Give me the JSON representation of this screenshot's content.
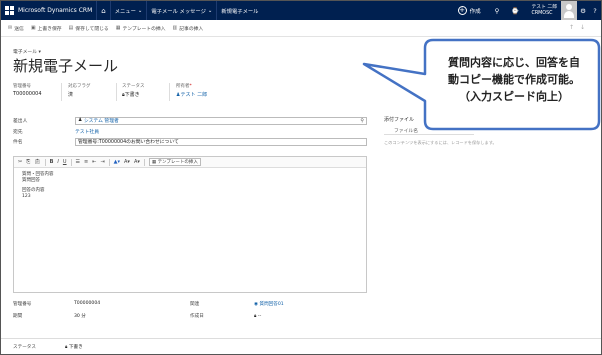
{
  "topnav": {
    "brand": "Microsoft Dynamics CRM",
    "menu_label": "メニュー",
    "area_label": "電子メール メッセージ",
    "record_label": "新規電子メール",
    "new_label": "作成",
    "user_name": "テスト 二郎",
    "user_org": "CRMOSC"
  },
  "commands": [
    {
      "icon": "save-icon",
      "label": "送信"
    },
    {
      "icon": "save-icon",
      "label": "上書き保存"
    },
    {
      "icon": "save-close-icon",
      "label": "保存して閉じる"
    },
    {
      "icon": "template-icon",
      "label": "テンプレートの挿入"
    },
    {
      "icon": "article-icon",
      "label": "記事の挿入"
    }
  ],
  "header": {
    "entity_label": "電子メール",
    "title": "新規電子メール",
    "fields": [
      {
        "label": "管理番号",
        "value": "T00000004"
      },
      {
        "label": "対応フラグ",
        "value": "済"
      },
      {
        "label": "ステータス",
        "value": "下書き"
      },
      {
        "label": "所有者",
        "value": "テスト 二郎"
      }
    ]
  },
  "form": {
    "from_label": "差出人",
    "from_value": "システム 管理者",
    "to_label": "宛先",
    "to_value": "テスト社員",
    "subject_label": "件名",
    "subject_value": "管理番号:T00000004のお問い合わせについて"
  },
  "editor": {
    "template_button": "テンプレートの挿入",
    "body_lines": [
      "質問・回答内容",
      "質問回答",
      "",
      "回答の内容",
      "123"
    ]
  },
  "footer_fields": {
    "mgmt_label": "管理番号",
    "mgmt_value": "T00000004",
    "duration_label": "期間",
    "duration_value": "30 分",
    "regarding_label": "関連",
    "regarding_value": "質問回答01",
    "due_label": "作成日",
    "due_value": "--",
    "status_label": "ステータス",
    "status_value": "下書き"
  },
  "attachments": {
    "title": "添付ファイル",
    "column": "ファイル名",
    "empty_note": "このコンテンツを表示にするには、レコードを保存します。"
  },
  "callout": {
    "lines": [
      "質問内容に応じ、回答を自",
      "動コピー機能で作成可能。",
      "（入力スピード向上）"
    ]
  }
}
